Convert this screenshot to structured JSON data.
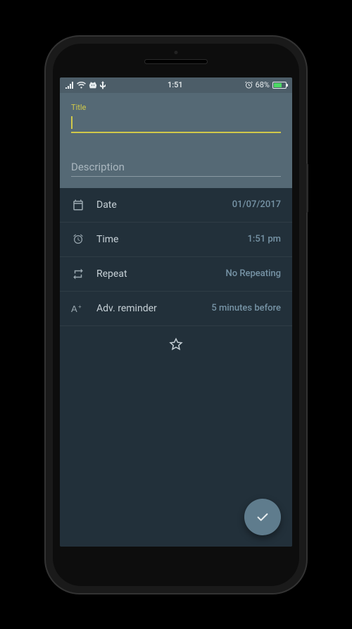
{
  "status": {
    "time": "1:51",
    "battery_pct": "68%"
  },
  "form": {
    "title_label": "Title",
    "title_value": "",
    "description_placeholder": "Description",
    "description_value": ""
  },
  "rows": {
    "date": {
      "label": "Date",
      "value": "01/07/2017"
    },
    "time": {
      "label": "Time",
      "value": "1:51 pm"
    },
    "repeat": {
      "label": "Repeat",
      "value": "No Repeating"
    },
    "reminder": {
      "label": "Adv. reminder",
      "value": "5 minutes before"
    }
  }
}
